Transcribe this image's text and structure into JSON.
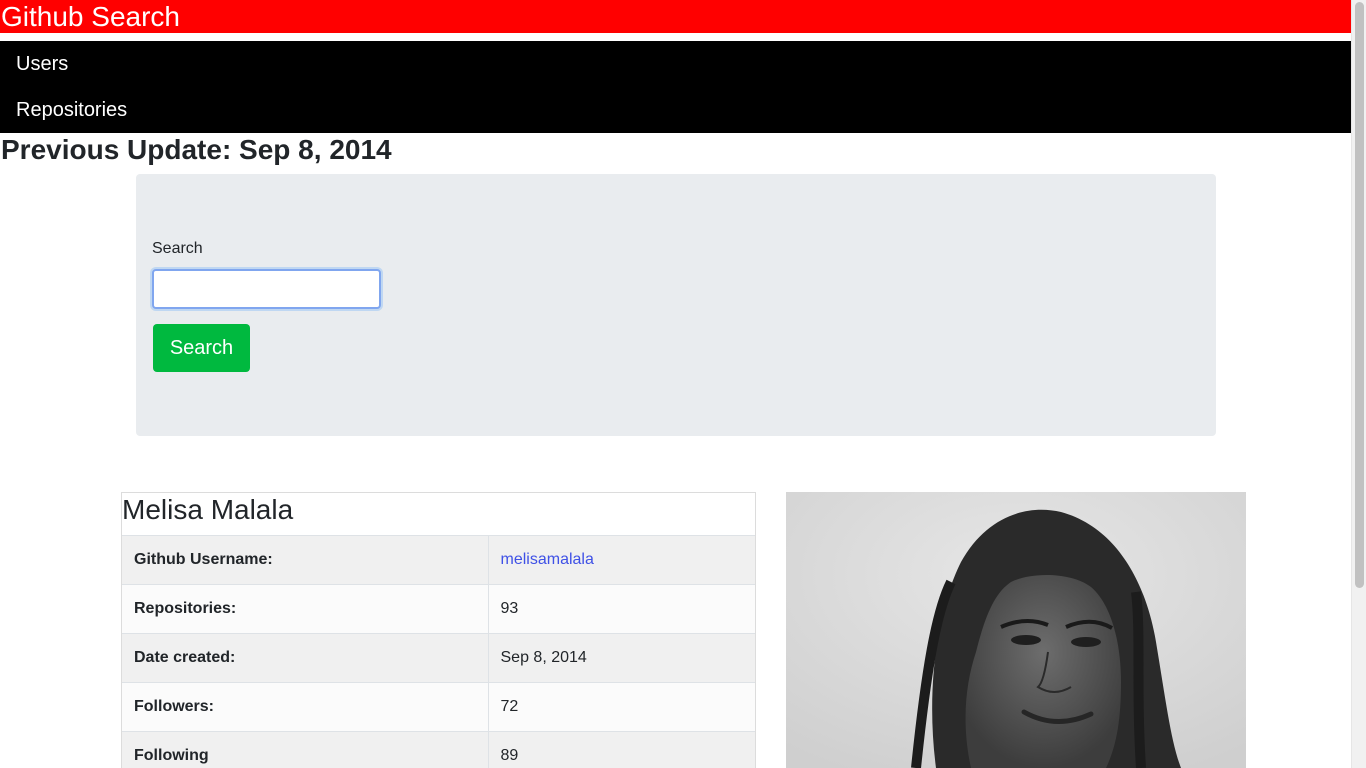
{
  "header": {
    "title": "Github Search"
  },
  "nav": {
    "items": [
      {
        "label": "Users"
      },
      {
        "label": "Repositories"
      }
    ]
  },
  "update": {
    "text": "Previous Update: Sep 8, 2014"
  },
  "search": {
    "label": "Search",
    "input_value": "",
    "placeholder": "",
    "button_label": "Search"
  },
  "profile": {
    "name": "Melisa Malala",
    "rows": [
      {
        "key": "Github Username:",
        "value": "melisamalala"
      },
      {
        "key": "Repositories:",
        "value": "93"
      },
      {
        "key": "Date created:",
        "value": "Sep 8, 2014"
      },
      {
        "key": "Followers:",
        "value": "72"
      },
      {
        "key": "Following",
        "value": "89"
      }
    ]
  },
  "colors": {
    "header_bg": "#ff0000",
    "nav_bg": "#000000",
    "button_bg": "#00b93f",
    "link": "#3f51e6",
    "panel_bg": "#e9ecef"
  }
}
